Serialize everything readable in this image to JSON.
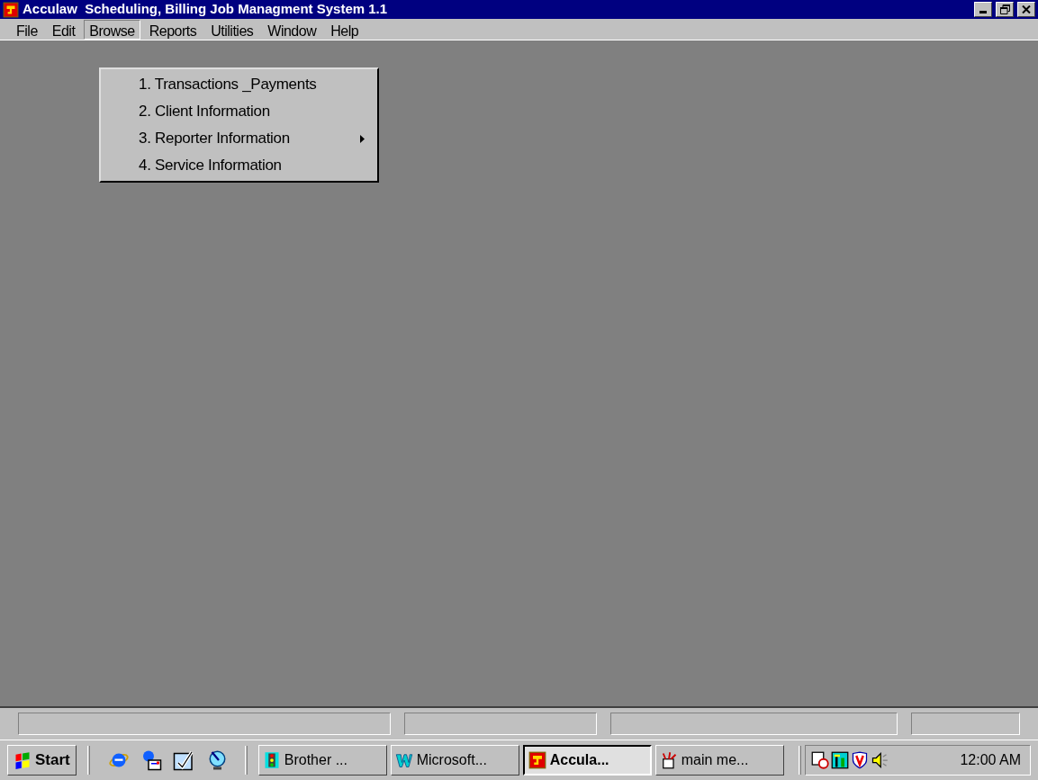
{
  "window": {
    "title": "Acculaw  Scheduling, Billing Job Managment System 1.1"
  },
  "menu_bar": [
    {
      "label": "File",
      "selected": false
    },
    {
      "label": "Edit",
      "selected": false
    },
    {
      "label": "Browse",
      "selected": true
    },
    {
      "label": "Reports",
      "selected": false
    },
    {
      "label": "Utilities",
      "selected": false
    },
    {
      "label": "Window",
      "selected": false
    },
    {
      "label": "Help",
      "selected": false
    }
  ],
  "dropdown": [
    {
      "label": "1. Transactions _Payments",
      "submenu": false
    },
    {
      "label": "2. Client Information",
      "submenu": false
    },
    {
      "label": "3. Reporter Information",
      "submenu": true
    },
    {
      "label": "4. Service Information",
      "submenu": false
    }
  ],
  "taskbar": {
    "start": "Start",
    "tasks": [
      {
        "label": "Brother ...",
        "selected": false,
        "kind": "printer"
      },
      {
        "label": "Microsoft...",
        "selected": false,
        "kind": "word"
      },
      {
        "label": "Accula...",
        "selected": true,
        "kind": "app"
      },
      {
        "label": "main me...",
        "selected": false,
        "kind": "paint"
      }
    ],
    "clock": "12:00 AM"
  }
}
